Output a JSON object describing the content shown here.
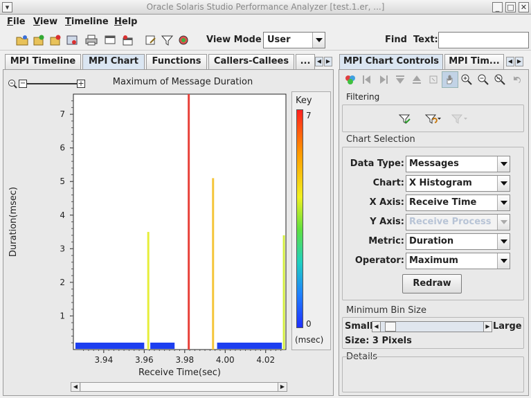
{
  "window": {
    "title": "Oracle Solaris Studio Performance Analyzer [test.1.er, ...]"
  },
  "menu": [
    {
      "label": "File",
      "key": "F"
    },
    {
      "label": "View",
      "key": "V"
    },
    {
      "label": "Timeline",
      "key": "T"
    },
    {
      "label": "Help",
      "key": "H"
    }
  ],
  "toolbar": {
    "view_mode_label": "View Mode",
    "view_mode_value": "User",
    "find_label": "Find",
    "text_label": "Text:",
    "text_value": ""
  },
  "left_tabs": [
    "MPI Timeline",
    "MPI Chart",
    "Functions",
    "Callers-Callees",
    "..."
  ],
  "right_tabs": [
    "MPI Chart Controls",
    "MPI Tim..."
  ],
  "chart_data": {
    "type": "bar",
    "title": "Maximum of Message Duration",
    "xlabel": "Receive Time(sec)",
    "ylabel": "Duration(msec)",
    "xlim": [
      3.925,
      4.03
    ],
    "ylim": [
      0,
      7.6
    ],
    "xticks": [
      3.94,
      3.96,
      3.98,
      4.0,
      4.02
    ],
    "xtick_labels": [
      "3.94",
      "3.96",
      "3.98",
      "4.00",
      "4.02"
    ],
    "yticks": [
      1,
      2,
      3,
      4,
      5,
      6,
      7
    ],
    "ytick_labels": [
      "1",
      "2",
      "3",
      "4",
      "5",
      "6",
      "7"
    ],
    "spikes": [
      {
        "x": 3.962,
        "y": 3.5,
        "color": "#e6ee3a"
      },
      {
        "x": 3.982,
        "y": 7.6,
        "color": "#e8413a"
      },
      {
        "x": 3.994,
        "y": 5.1,
        "color": "#f5c53a"
      },
      {
        "x": 4.029,
        "y": 3.4,
        "color": "#d4ee40"
      }
    ],
    "baseline_segments": [
      {
        "from": 3.926,
        "to": 3.96,
        "color": "#1d3ff0"
      },
      {
        "from": 3.963,
        "to": 3.975,
        "color": "#1d3ff0"
      },
      {
        "from": 3.996,
        "to": 4.028,
        "color": "#1d3ff0"
      }
    ],
    "key": {
      "title": "Key",
      "max_label": "7",
      "min_label": "0",
      "unit": "(msec)"
    }
  },
  "controls": {
    "filtering_title": "Filtering",
    "chart_selection_title": "Chart Selection",
    "rows": [
      {
        "label": "Data Type:",
        "value": "Messages",
        "disabled": false
      },
      {
        "label": "Chart:",
        "value": "X Histogram",
        "disabled": false
      },
      {
        "label": "X Axis:",
        "value": "Receive Time",
        "disabled": false
      },
      {
        "label": "Y Axis:",
        "value": "Receive Process",
        "disabled": true
      },
      {
        "label": "Metric:",
        "value": "Duration",
        "disabled": false
      },
      {
        "label": "Operator:",
        "value": "Maximum",
        "disabled": false
      }
    ],
    "redraw_label": "Redraw",
    "bin_title": "Minimum Bin Size",
    "small_label": "Small",
    "large_label": "Large",
    "size_label": "Size: 3 Pixels",
    "details_title": "Details"
  }
}
